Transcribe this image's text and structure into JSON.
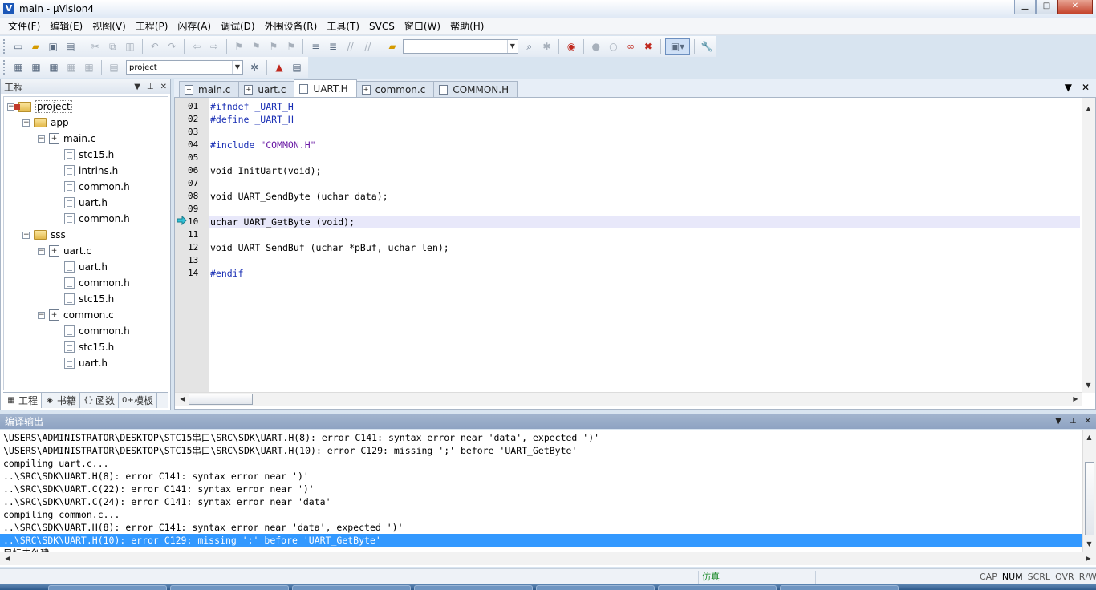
{
  "window": {
    "title": "main - µVision4",
    "minimize": "▁",
    "maximize": "□",
    "close": "✕"
  },
  "menu": [
    "文件(F)",
    "编辑(E)",
    "视图(V)",
    "工程(P)",
    "闪存(A)",
    "调试(D)",
    "外围设备(R)",
    "工具(T)",
    "SVCS",
    "窗口(W)",
    "帮助(H)"
  ],
  "toolbar2": {
    "target_combo": "project"
  },
  "project_panel": {
    "title": "工程",
    "tree": [
      {
        "label": "project",
        "kind": "project"
      },
      {
        "label": "app",
        "kind": "folder"
      },
      {
        "label": "main.c",
        "kind": "cfile"
      },
      {
        "label": "stc15.h",
        "kind": "hfile"
      },
      {
        "label": "intrins.h",
        "kind": "hfile"
      },
      {
        "label": "common.h",
        "kind": "hfile"
      },
      {
        "label": "uart.h",
        "kind": "hfile"
      },
      {
        "label": "common.h",
        "kind": "hfile"
      },
      {
        "label": "sss",
        "kind": "folder"
      },
      {
        "label": "uart.c",
        "kind": "cfile"
      },
      {
        "label": "uart.h",
        "kind": "hfile"
      },
      {
        "label": "common.h",
        "kind": "hfile"
      },
      {
        "label": "stc15.h",
        "kind": "hfile"
      },
      {
        "label": "common.c",
        "kind": "cfile"
      },
      {
        "label": "common.h",
        "kind": "hfile"
      },
      {
        "label": "stc15.h",
        "kind": "hfile"
      },
      {
        "label": "uart.h",
        "kind": "hfile"
      }
    ],
    "tabs": [
      {
        "label": "工程",
        "icon": "project-icon"
      },
      {
        "label": "书籍",
        "icon": "books-icon"
      },
      {
        "label": "函数",
        "icon": "functions-icon"
      },
      {
        "label": "模板",
        "icon": "templates-icon"
      }
    ]
  },
  "editor": {
    "tabs": [
      "main.c",
      "uart.c",
      "UART.H",
      "common.c",
      "COMMON.H"
    ],
    "active_tab": "UART.H",
    "current_line": "10",
    "lines": [
      {
        "no": "01",
        "text": "#ifndef _UART_H"
      },
      {
        "no": "02",
        "text": "#define _UART_H"
      },
      {
        "no": "03",
        "text": ""
      },
      {
        "no": "04",
        "text": "#include \"COMMON.H\""
      },
      {
        "no": "05",
        "text": ""
      },
      {
        "no": "06",
        "text": "void InitUart(void);"
      },
      {
        "no": "07",
        "text": ""
      },
      {
        "no": "08",
        "text": "void UART_SendByte (uchar data);"
      },
      {
        "no": "09",
        "text": ""
      },
      {
        "no": "10",
        "text": "uchar UART_GetByte (void);"
      },
      {
        "no": "11",
        "text": ""
      },
      {
        "no": "12",
        "text": "void UART_SendBuf (uchar *pBuf, uchar len);"
      },
      {
        "no": "13",
        "text": ""
      },
      {
        "no": "14",
        "text": "#endif"
      }
    ]
  },
  "output": {
    "title": "编译输出",
    "lines": [
      "\\USERS\\ADMINISTRATOR\\DESKTOP\\STC15串口\\SRC\\SDK\\UART.H(8): error C141: syntax error near 'data', expected ')'",
      "\\USERS\\ADMINISTRATOR\\DESKTOP\\STC15串口\\SRC\\SDK\\UART.H(10): error C129: missing ';' before 'UART_GetByte'",
      "compiling uart.c...",
      "..\\SRC\\SDK\\UART.H(8): error C141: syntax error near ')'",
      "..\\SRC\\SDK\\UART.C(22): error C141: syntax error near ')'",
      "..\\SRC\\SDK\\UART.C(24): error C141: syntax error near 'data'",
      "compiling common.c...",
      "..\\SRC\\SDK\\UART.H(8): error C141: syntax error near 'data', expected ')'",
      "..\\SRC\\SDK\\UART.H(10): error C129: missing ';' before 'UART_GetByte'",
      "目标未创建"
    ],
    "selected_index": 8
  },
  "status": {
    "mode": "仿真",
    "keys": [
      "CAP",
      "NUM",
      "SCRL",
      "OVR",
      "R/W"
    ],
    "active_key": "NUM"
  },
  "colors": {
    "preprocessor": "#1b30b5",
    "string": "#6a1ba5",
    "selection": "#3399ff",
    "current_line": "#e8e8fa",
    "simulation": "#1b8a2a"
  }
}
